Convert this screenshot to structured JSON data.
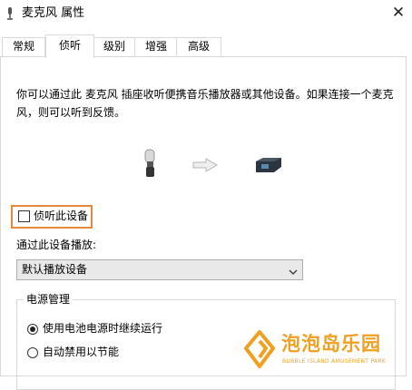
{
  "window": {
    "title": "麦克风 属性",
    "close_glyph": "✕"
  },
  "tabs": [
    {
      "label": "常规",
      "active": false
    },
    {
      "label": "侦听",
      "active": true
    },
    {
      "label": "级别",
      "active": false
    },
    {
      "label": "增强",
      "active": false
    },
    {
      "label": "高级",
      "active": false
    }
  ],
  "listen_tab": {
    "description": "你可以通过此 麦克风 插座收听便携音乐播放器或其他设备。如果连接一个麦克风，则可以听到反馈。",
    "illustration": {
      "source_icon": "microphone-icon",
      "arrow_icon": "arrow-right-icon",
      "target_icon": "speaker-device-icon"
    },
    "listen_checkbox": {
      "label": "侦听此设备",
      "checked": false,
      "highlight_color": "#e8863a"
    },
    "playback": {
      "label": "通过此设备播放:",
      "selected": "默认播放设备"
    },
    "power": {
      "title": "电源管理",
      "options": [
        {
          "label": "使用电池电源时继续运行",
          "selected": true
        },
        {
          "label": "自动禁用以节能",
          "selected": false
        }
      ]
    }
  },
  "watermark": {
    "text": "泡泡岛乐园",
    "subtext": "BUBBLE ISLAND AMUSEMENT PARK",
    "color": "#f0a020"
  }
}
